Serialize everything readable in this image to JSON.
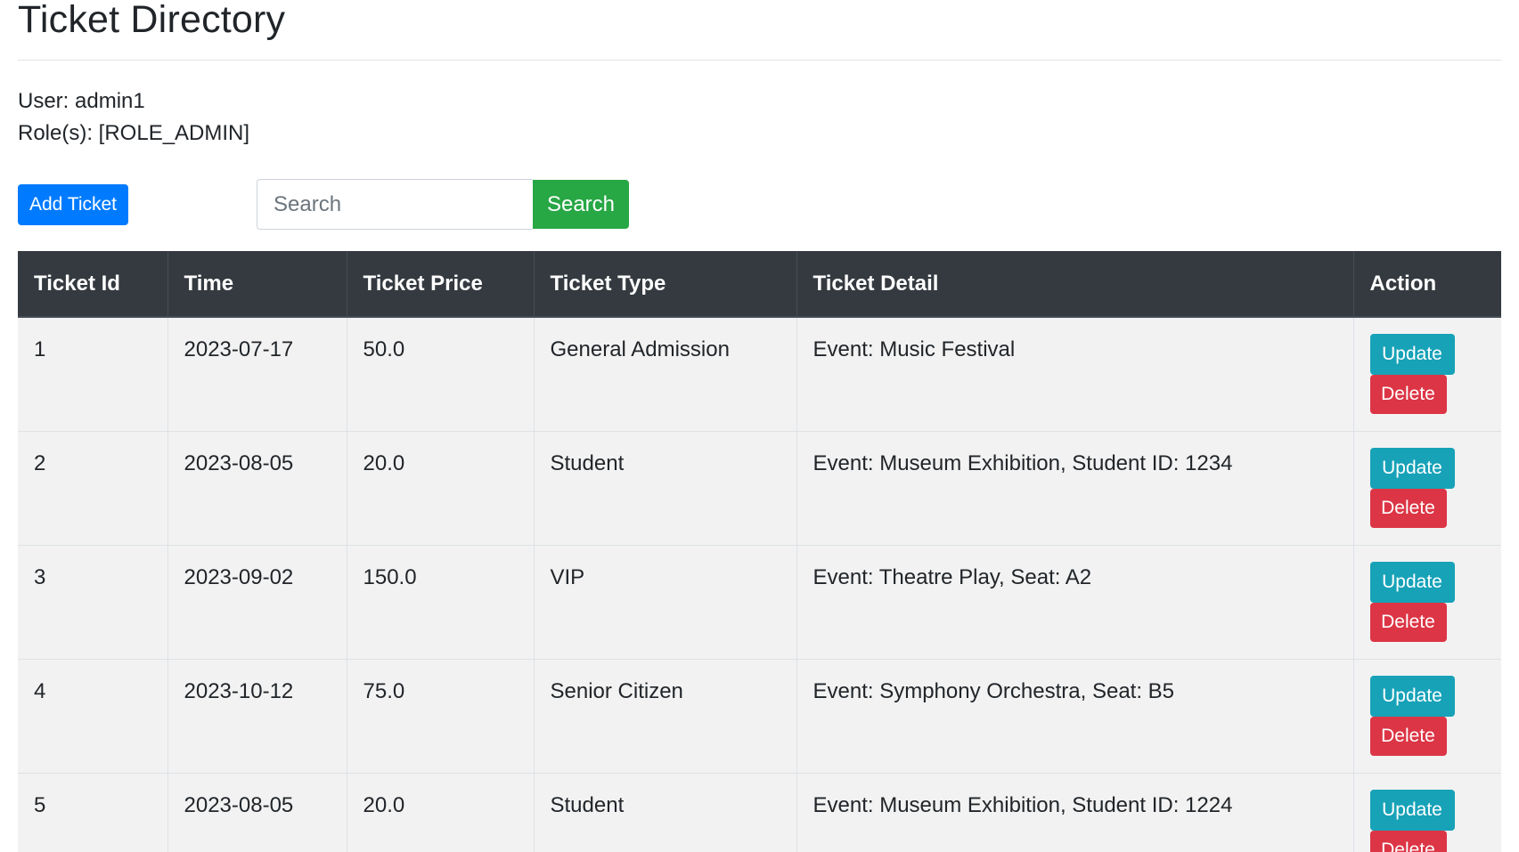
{
  "header": {
    "title": "Ticket Directory"
  },
  "user": {
    "user_line": "User: admin1",
    "role_line": "Role(s): [ROLE_ADMIN]"
  },
  "toolbar": {
    "add_label": "Add Ticket",
    "search_placeholder": "Search",
    "search_label": "Search"
  },
  "table": {
    "columns": [
      "Ticket Id",
      "Time",
      "Ticket Price",
      "Ticket Type",
      "Ticket Detail",
      "Action"
    ],
    "rows": [
      {
        "id": "1",
        "time": "2023-07-17",
        "price": "50.0",
        "type": "General Admission",
        "detail": "Event: Music Festival"
      },
      {
        "id": "2",
        "time": "2023-08-05",
        "price": "20.0",
        "type": "Student",
        "detail": "Event: Museum Exhibition, Student ID: 1234"
      },
      {
        "id": "3",
        "time": "2023-09-02",
        "price": "150.0",
        "type": "VIP",
        "detail": "Event: Theatre Play, Seat: A2"
      },
      {
        "id": "4",
        "time": "2023-10-12",
        "price": "75.0",
        "type": "Senior Citizen",
        "detail": "Event: Symphony Orchestra, Seat: B5"
      },
      {
        "id": "5",
        "time": "2023-08-05",
        "price": "20.0",
        "type": "Student",
        "detail": "Event: Museum Exhibition, Student ID: 1224"
      }
    ],
    "update_label": "Update",
    "delete_label": "Delete"
  },
  "colors": {
    "primary": "#007bff",
    "success": "#28a745",
    "info": "#17a2b8",
    "danger": "#dc3545",
    "table_header": "#343a40",
    "row_background": "#f2f2f2"
  }
}
